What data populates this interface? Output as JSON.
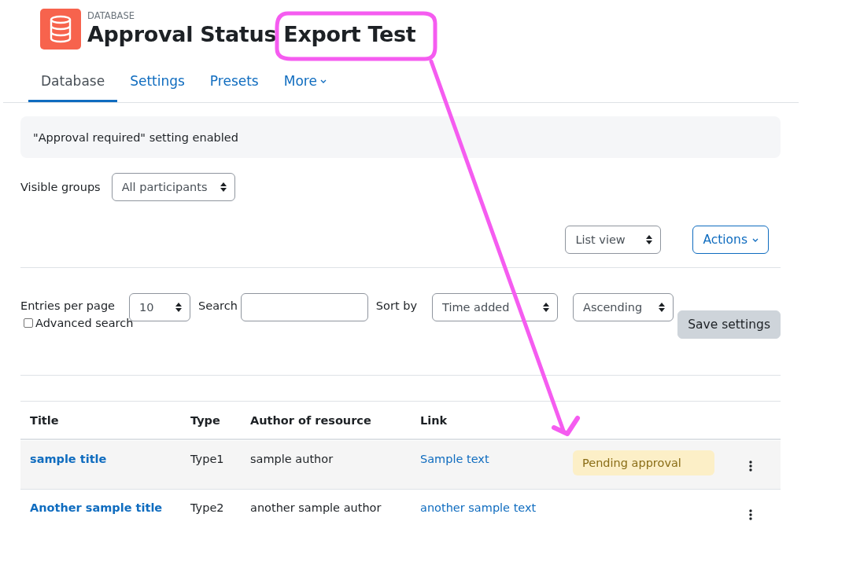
{
  "header": {
    "eyebrow": "DATABASE",
    "title": "Approval Status Export Test"
  },
  "tabs": [
    {
      "label": "Database",
      "selected": true,
      "kind": "plain"
    },
    {
      "label": "Settings",
      "selected": false,
      "kind": "plain"
    },
    {
      "label": "Presets",
      "selected": false,
      "kind": "plain"
    },
    {
      "label": "More",
      "selected": false,
      "kind": "dropdown"
    }
  ],
  "alert": "\"Approval required\" setting enabled",
  "groups": {
    "label": "Visible groups",
    "value": "All participants"
  },
  "view": {
    "value": "List view",
    "actions": "Actions"
  },
  "filters": {
    "entries_label": "Entries per page",
    "entries_value": "10",
    "search_label": "Search",
    "sort_label": "Sort by",
    "sort_value": "Time added",
    "order_value": "Ascending",
    "advanced_label": "Advanced search",
    "advanced_checked": false,
    "save": "Save settings"
  },
  "table": {
    "columns": [
      "Title",
      "Type",
      "Author of resource",
      "Link"
    ],
    "rows": [
      {
        "title": "sample title",
        "type": "Type1",
        "author": "sample author",
        "link": "Sample text",
        "status": "Pending approval",
        "highlighted": true
      },
      {
        "title": "Another sample title",
        "type": "Type2",
        "author": "another sample author",
        "link": "another sample text",
        "highlighted": false
      }
    ]
  }
}
